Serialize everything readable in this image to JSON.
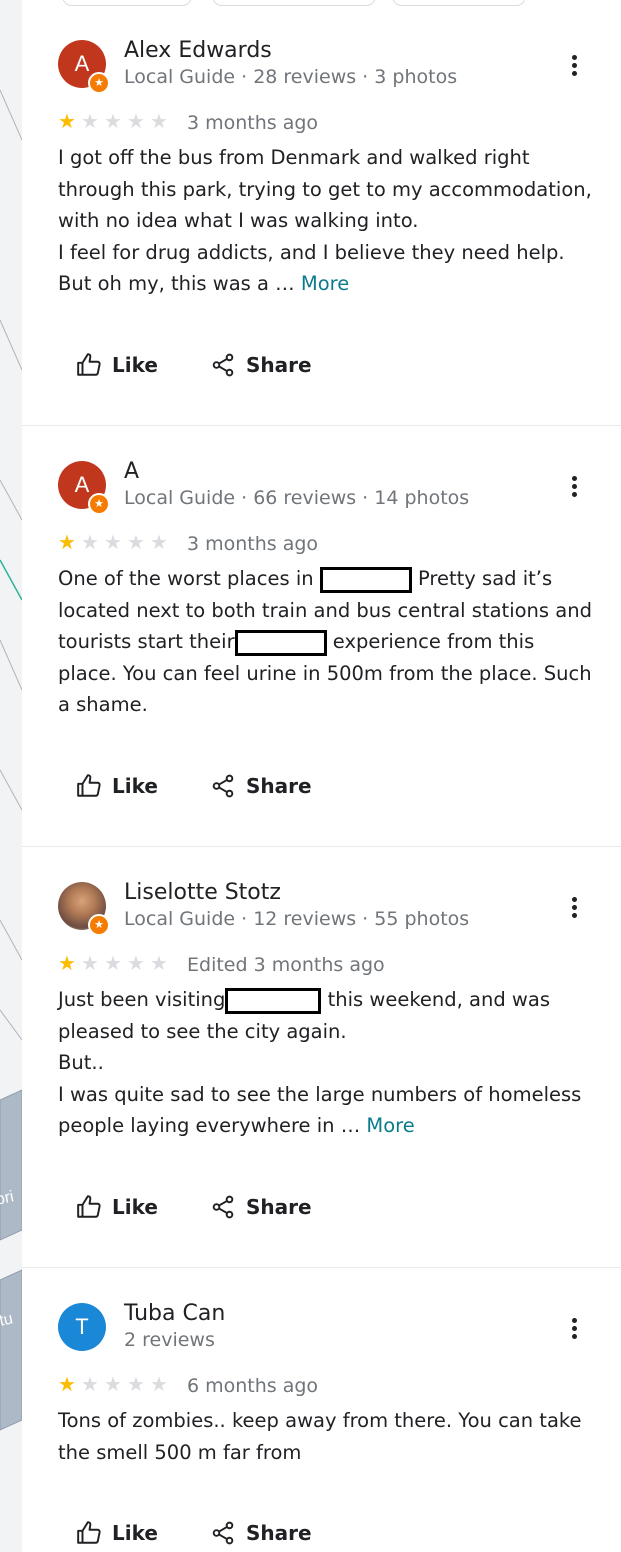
{
  "reviews": [
    {
      "name": "Alex Edwards",
      "meta": "Local Guide · 28 reviews · 3 photos",
      "avatar_letter": "A",
      "avatar_color": "#c1371d",
      "rating": 1,
      "date": "3 months ago",
      "lines": [
        "I got off the bus from Denmark and walked right",
        "through this park, trying to get to my accommodation,",
        "with no idea what I was walking into.",
        "I feel for drug addicts, and I believe they need help.",
        "But oh my, this was a …"
      ],
      "more_label": "More",
      "like_label": "Like",
      "share_label": "Share"
    },
    {
      "name": "A",
      "meta": "Local Guide · 66 reviews · 14 photos",
      "avatar_letter": "A",
      "avatar_color": "#c1371d",
      "rating": 1,
      "date": "3 months ago",
      "line1_a": "One of the worst places in",
      "line1_b": "Pretty sad it’s",
      "line2": "located next to both train and bus central stations and",
      "line3_a": "tourists start their",
      "line3_b": "experience from this",
      "line4": "place. You can feel urine in 500m from the place. Such",
      "line5": "a shame.",
      "like_label": "Like",
      "share_label": "Share"
    },
    {
      "name": "Liselotte Stotz",
      "meta": "Local Guide · 12 reviews · 55 photos",
      "avatar_color": "#8d6e63",
      "rating": 1,
      "date": "Edited 3 months ago",
      "line1_a": "Just been visiting",
      "line1_b": "this weekend, and was",
      "line2": "pleased to see the city again.",
      "line3": "But..",
      "line4": "I was quite sad to see the large numbers of homeless",
      "line5": "people laying everywhere in …",
      "more_label": "More",
      "like_label": "Like",
      "share_label": "Share"
    },
    {
      "name": "Tuba Can",
      "meta": "2 reviews",
      "avatar_letter": "T",
      "avatar_color": "#1a88d6",
      "rating": 1,
      "date": "6 months ago",
      "lines": [
        "Tons of zombies.. keep away from there. You can take",
        "the smell 500 m far from"
      ],
      "like_label": "Like",
      "share_label": "Share"
    }
  ],
  "map_labels": [
    "ori",
    "ltu"
  ],
  "colors": {
    "star_on": "#fbbc04",
    "star_off": "#dadce0",
    "more_link": "#0b7b8c",
    "guide_badge": "#f57c00"
  },
  "icons": [
    "like-icon",
    "share-icon",
    "more-options-icon",
    "local-guide-badge-icon"
  ]
}
